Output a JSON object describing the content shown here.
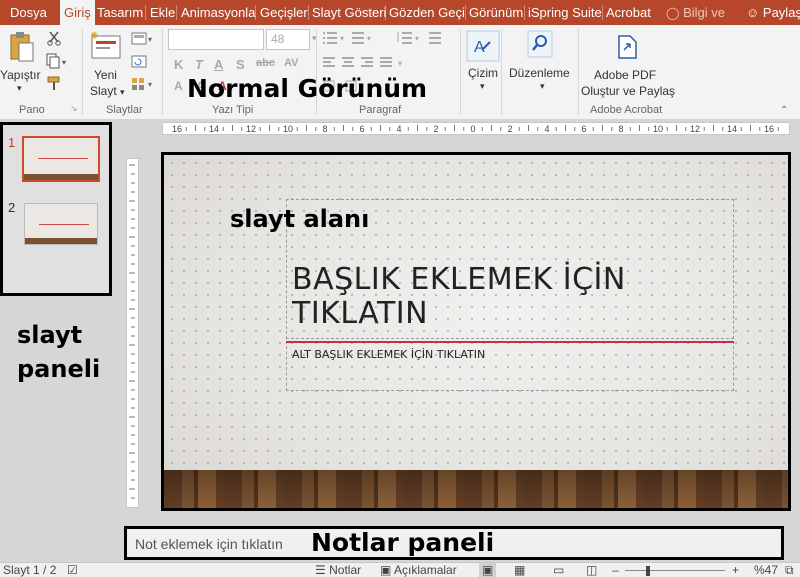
{
  "tabs": [
    "Dosya",
    "Giriş",
    "Tasarım",
    "Ekle",
    "Animasyonla",
    "Geçişler",
    "Slayt Gösteri",
    "Gözden Geçi",
    "Görünüm",
    "iSpring Suite",
    "Acrobat",
    "Bilgi ve",
    "Paylaş"
  ],
  "ribbon": {
    "paste_label": "Yapıştır",
    "new_slide_label_1": "Yeni",
    "new_slide_label_2": "Slayt",
    "font_size": "48",
    "draw_label": "Çizim",
    "edit_label": "Düzenleme",
    "adobe_label_1": "Adobe PDF",
    "adobe_label_2": "Oluştur ve Paylaş",
    "groups": {
      "clipboard": "Pano",
      "slides": "Slaytlar",
      "font": "Yazı Tipi",
      "paragraph": "Paragraf",
      "adobe": "Adobe Acrobat"
    }
  },
  "ruler_labels": [
    "16",
    "14",
    "12",
    "10",
    "8",
    "6",
    "4",
    "2",
    "0",
    "2",
    "4",
    "6",
    "8",
    "10",
    "12",
    "14",
    "16"
  ],
  "slide_panel": {
    "numbers": [
      "1",
      "2"
    ]
  },
  "slide": {
    "title": "BAŞLIK EKLEMEK İÇİN TIKLATIN",
    "title_line1": "BAŞLIK EKLEMEK İÇİN",
    "title_line2": "TIKLATIN",
    "subtitle": "ALT BAŞLIK EKLEMEK İÇİN TIKLATIN"
  },
  "annotations": {
    "normal_view": "Normal Görünüm",
    "slide_area": "slayt alanı",
    "slide_panel_1": "slayt",
    "slide_panel_2": "paneli",
    "notes_panel": "Notlar paneli"
  },
  "notes": {
    "placeholder": "Not eklemek için tıklatın"
  },
  "status": {
    "slide_counter": "Slayt 1 / 2",
    "notes_button": "Notlar",
    "comments_button": "Açıklamalar",
    "zoom": "%47"
  },
  "colors": {
    "accent": "#b7472a",
    "title_line": "#c4304a"
  }
}
